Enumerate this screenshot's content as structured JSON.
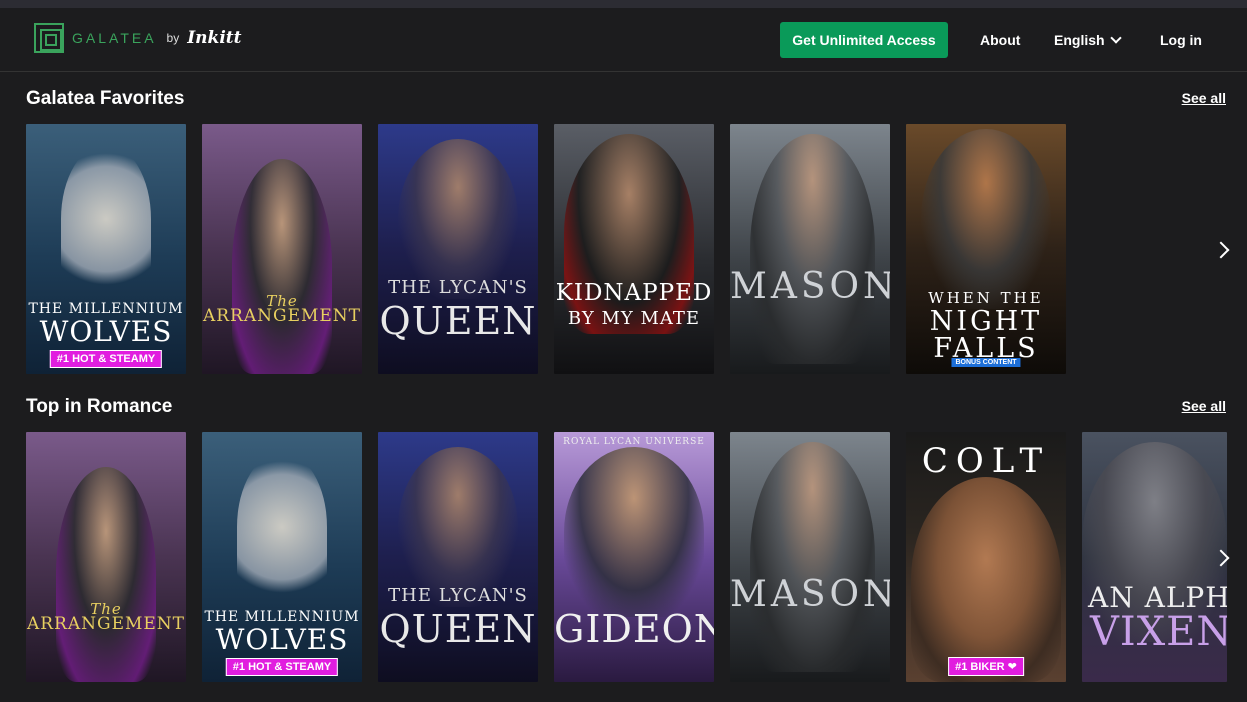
{
  "header": {
    "logo_text": "GALATEA",
    "logo_by": "by",
    "logo_brand": "Inkitt",
    "cta_label": "Get Unlimited Access",
    "about_label": "About",
    "language_label": "English",
    "login_label": "Log in"
  },
  "sections": [
    {
      "title": "Galatea Favorites",
      "see_all": "See all",
      "books": [
        {
          "title_top": "THE MILLENNIUM",
          "title_main": "WOLVES",
          "badge": "#1 HOT & STEAMY"
        },
        {
          "title_top": "The",
          "title_main": "ARRANGEMENT",
          "badge": ""
        },
        {
          "title_top": "THE LYCAN'S",
          "title_main": "QUEEN",
          "badge": ""
        },
        {
          "title_top": "KIDNAPPED",
          "title_main": "BY MY MATE",
          "badge": ""
        },
        {
          "title_top": "",
          "title_main": "MASON",
          "badge": ""
        },
        {
          "title_top": "WHEN THE",
          "title_main": "NIGHT FALLS",
          "badge": "BONUS CONTENT"
        }
      ]
    },
    {
      "title": "Top in Romance",
      "see_all": "See all",
      "books": [
        {
          "title_top": "The",
          "title_main": "ARRANGEMENT",
          "badge": ""
        },
        {
          "title_top": "THE MILLENNIUM",
          "title_main": "WOLVES",
          "badge": "#1 HOT & STEAMY"
        },
        {
          "title_top": "THE LYCAN'S",
          "title_main": "QUEEN",
          "badge": ""
        },
        {
          "title_top": "ROYAL LYCAN UNIVERSE",
          "title_main": "GIDEON",
          "badge": ""
        },
        {
          "title_top": "",
          "title_main": "MASON",
          "badge": ""
        },
        {
          "title_top": "COLT",
          "title_main": "",
          "badge": "#1 BIKER ❤"
        },
        {
          "title_top": "AN ALPHA",
          "title_main": "VIXEN",
          "badge": ""
        }
      ]
    }
  ],
  "icons": {
    "next": "chevron-right-icon",
    "dropdown": "chevron-down-icon",
    "logo": "galatea-logo-icon"
  },
  "colors": {
    "background": "#1c1c1e",
    "brand_green": "#0a9a59",
    "logo_green": "#3aa35c",
    "badge_magenta": "#e11ddf",
    "badge_blue": "#1d6fd8"
  }
}
